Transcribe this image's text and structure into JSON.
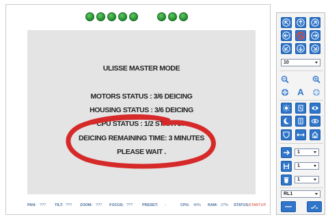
{
  "leds": {
    "group_a_count": 5,
    "group_b_count": 3,
    "color": "#1e8a2c"
  },
  "screen": {
    "title": "ULISSE MASTER MODE",
    "lines": [
      "MOTORS STATUS : 3/6 DEICING",
      "HOUSING STATUS : 3/6 DEICING",
      "CPU STATUS : 1/2 STARTUP",
      "DEICING REMAINING TIME: 3 MINUTES",
      "PLEASE WAIT ."
    ],
    "highlight_color": "#d62a2a"
  },
  "status_bar": {
    "pan_label": "PAN:",
    "pan_value": "???",
    "tilt_label": "TILT:",
    "tilt_value": "???",
    "zoom_label": "ZOOM:",
    "zoom_value": "???",
    "focus_label": "FOCUS:",
    "focus_value": "???",
    "preset_label": "PRESET:",
    "preset_value": "-",
    "cpu_label": "CPU:",
    "cpu_value": "40%",
    "ram_label": "RAM:",
    "ram_value": "27%",
    "status_label": "STATUS:",
    "status_value": "STARTUP",
    "status_value_color": "#d53a2a"
  },
  "controls": {
    "accent": "#2f75c9",
    "speed_select": "10",
    "preset_select": "1",
    "save_select": "1",
    "delete_select": "1",
    "relay_select": "RL1",
    "zoom_text_icon": "A"
  }
}
